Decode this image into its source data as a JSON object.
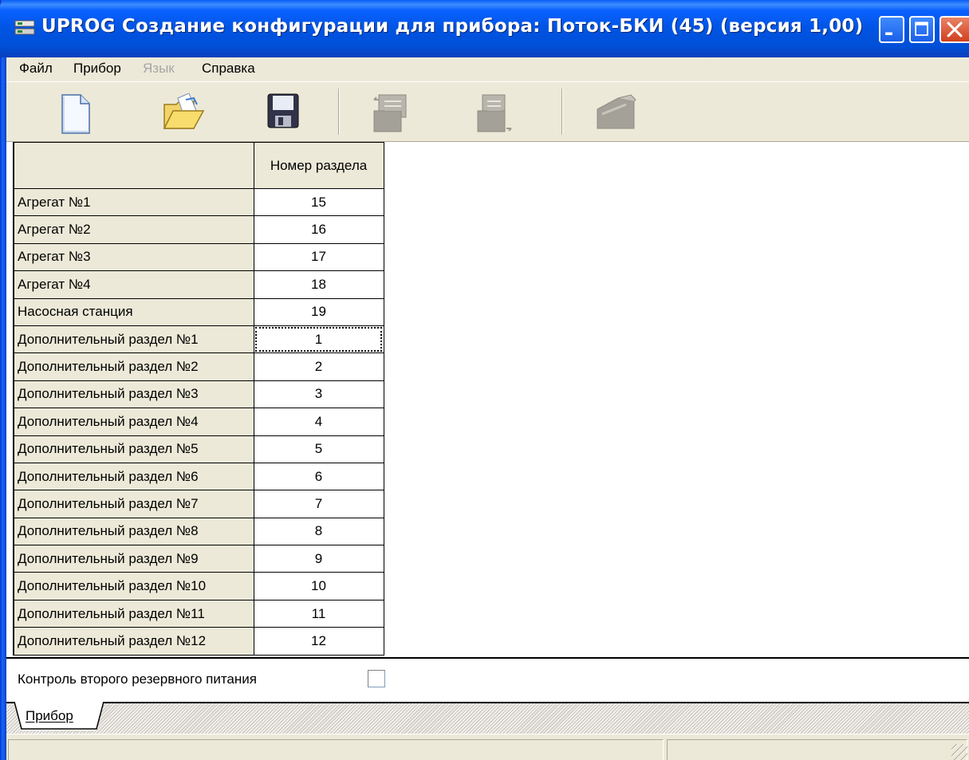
{
  "window": {
    "title": "UPROG  Создание конфигурации для прибора: Поток-БКИ  (45) (версия  1,00)"
  },
  "menu": {
    "items": [
      {
        "label": "Файл",
        "enabled": true
      },
      {
        "label": "Прибор",
        "enabled": true
      },
      {
        "label": "Язык",
        "enabled": false
      },
      {
        "label": "Справка",
        "enabled": true
      }
    ]
  },
  "toolbar": {
    "buttons": [
      {
        "icon": "new-document-icon",
        "enabled": true
      },
      {
        "icon": "open-folder-icon",
        "enabled": true
      },
      {
        "icon": "save-floppy-icon",
        "enabled": true
      },
      {
        "icon": "read-from-device-icon",
        "enabled": false
      },
      {
        "icon": "write-to-device-icon",
        "enabled": false
      },
      {
        "icon": "device-icon",
        "enabled": false
      }
    ]
  },
  "grid": {
    "column_header": "Номер раздела",
    "rows": [
      {
        "label": "Агрегат №1",
        "value": "15"
      },
      {
        "label": "Агрегат №2",
        "value": "16"
      },
      {
        "label": "Агрегат №3",
        "value": "17"
      },
      {
        "label": "Агрегат №4",
        "value": "18"
      },
      {
        "label": "Насосная станция",
        "value": "19"
      },
      {
        "label": "Дополнительный раздел №1",
        "value": "1"
      },
      {
        "label": "Дополнительный раздел №2",
        "value": "2"
      },
      {
        "label": "Дополнительный раздел №3",
        "value": "3"
      },
      {
        "label": "Дополнительный раздел №4",
        "value": "4"
      },
      {
        "label": "Дополнительный раздел №5",
        "value": "5"
      },
      {
        "label": "Дополнительный раздел №6",
        "value": "6"
      },
      {
        "label": "Дополнительный раздел №7",
        "value": "7"
      },
      {
        "label": "Дополнительный раздел №8",
        "value": "8"
      },
      {
        "label": "Дополнительный раздел №9",
        "value": "9"
      },
      {
        "label": "Дополнительный раздел №10",
        "value": "10"
      },
      {
        "label": "Дополнительный раздел №11",
        "value": "11"
      },
      {
        "label": "Дополнительный раздел №12",
        "value": "12"
      }
    ],
    "focused_row": 5
  },
  "options": {
    "backup_power_label": "Контроль второго резервного питания",
    "backup_power_checked": false
  },
  "tabs": [
    {
      "label": "Прибор",
      "active": true
    }
  ],
  "statusbar": {
    "panes": [
      "",
      ""
    ]
  }
}
